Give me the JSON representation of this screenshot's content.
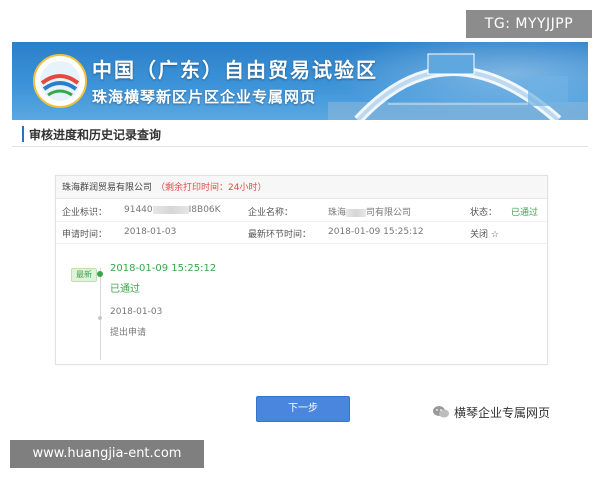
{
  "watermark_top": "TG: MYYJJPP",
  "banner": {
    "title_line1": "中国（广东）自由贸易试验区",
    "title_line2": "珠海横琴新区片区企业专属网页"
  },
  "section_title": "审核进度和历史记录查询",
  "card": {
    "company_name": "珠海群润贸易有限公司",
    "print_time_note": "（剩余打印时间：24小时）",
    "row1": {
      "id_label": "企业标识：",
      "id_prefix": "91440",
      "id_suffix": "I8B06K",
      "name_label": "企业名称：",
      "name_prefix": "珠海",
      "name_suffix": "司有限公司",
      "status_label": "状态：",
      "status_value": "已通过"
    },
    "row2": {
      "apply_label": "申请时间：",
      "apply_value": "2018-01-03",
      "latest_label": "最新环节时间：",
      "latest_value": "2018-01-09 15:25:12",
      "close_label": "关闭 ☆"
    },
    "timeline": {
      "badge": "最新",
      "item1_time": "2018-01-09 15:25:12",
      "item1_status": "已通过",
      "item2_time": "2018-01-03",
      "item2_status": "提出申请"
    }
  },
  "next_button": "下一步",
  "wechat_watermark": "横琴企业专属网页",
  "url_watermark": "www.huangjia-ent.com",
  "colors": {
    "banner_blue": "#2a7fc9",
    "accent_green": "#3aa64a",
    "warning_red": "#e14b4b",
    "button_blue": "#4a86de"
  }
}
